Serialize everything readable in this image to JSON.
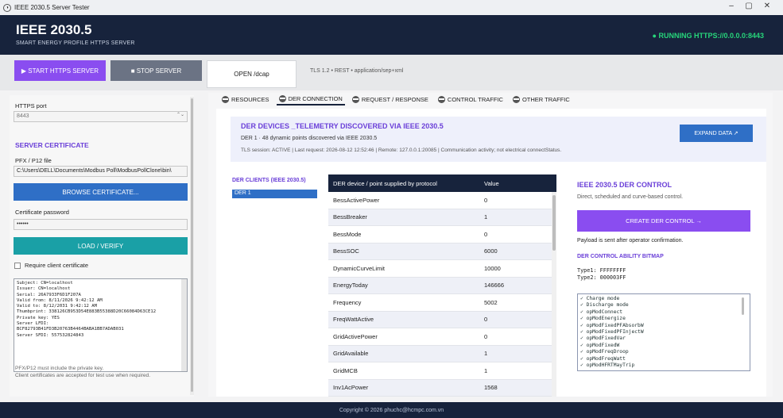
{
  "window": {
    "title": "IEEE 2030.5 Server Tester"
  },
  "header": {
    "title": "IEEE 2030.5",
    "subtitle": "SMART ENERGY PROFILE HTTPS SERVER",
    "status": "● RUNNING HTTPS://0.0.0.0:8443"
  },
  "toolbar": {
    "start_label": "▶  START HTTPS SERVER",
    "stop_label": "■  STOP SERVER",
    "open_label": "OPEN /dcap",
    "info": "TLS 1.2 • REST • application/sep+xml"
  },
  "left": {
    "port_label": "HTTPS port",
    "port_value": "8443",
    "cert_heading": "SERVER CERTIFICATE",
    "pfx_label": "PFX / P12 file",
    "pfx_value": "C:\\Users\\DELL\\Documents\\Modbus Poll\\ModbusPollClone\\bin\\",
    "browse_label": "BROWSE CERTIFICATE...",
    "password_label": "Certificate password",
    "password_value": "••••••",
    "load_label": "LOAD / VERIFY",
    "require_label": "Require client certificate",
    "cert_info": "Subject: CN=localhost\nIssuer: CN=localhost\nSerial: 26A7933F6D1F207A\nValid from: 8/11/2026 9:42:12 AM\nValid to: 8/12/2031 9:42:12 AM\nThumbprint: 338126CB953D54E883B55388D20C66084D63CE12\nPrivate key: YES\nServer LFDI:\nBCF82793B41FD3B20763B4464BABA1BB7ADAB031\nServer SFDI: 557532824843",
    "note1": "PFX/P12 must include the private key.",
    "note2": "Client certificates are accepted for test use when required."
  },
  "tabs": [
    "RESOURCES",
    "DER CONNECTION",
    "REQUEST / RESPONSE",
    "CONTROL TRAFFIC",
    "OTHER TRAFFIC"
  ],
  "der": {
    "banner_title": "DER DEVICES _TELEMETRY DISCOVERED VIA IEEE 2030.5",
    "banner_sub": "DER 1 · 48 dynamic points discovered via IEEE 2030.5",
    "banner_status": "TLS session: ACTIVE  |  Last request: 2026-08-12 12:52:46  |  Remote: 127.0.0.1:20085  |  Communication activity; not electrical connectStatus.",
    "expand_label": "EXPAND DATA ↗",
    "clients_heading": "DER CLIENTS (IEEE 2030.5)",
    "clients": [
      "DER 1"
    ],
    "table_headers": [
      "DER device / point supplied by protocol",
      "Value"
    ],
    "rows": [
      [
        "BessActivePower",
        "0"
      ],
      [
        "BessBreaker",
        "1"
      ],
      [
        "BessMode",
        "0"
      ],
      [
        "BessSOC",
        "6000"
      ],
      [
        "DynamicCurveLimit",
        "10000"
      ],
      [
        "EnergyToday",
        "146666"
      ],
      [
        "Frequency",
        "5002"
      ],
      [
        "FreqWattActive",
        "0"
      ],
      [
        "GridActivePower",
        "0"
      ],
      [
        "GridAvailable",
        "1"
      ],
      [
        "GridMCB",
        "1"
      ],
      [
        "Inv1AcPower",
        "1568"
      ]
    ]
  },
  "control": {
    "title": "IEEE 2030.5 DER CONTROL",
    "sub": "Direct, scheduled and curve-based control.",
    "create_label": "CREATE DER CONTROL →",
    "payload_note": "Payload is sent after operator confirmation.",
    "bitmap_heading": "DER CONTROL ABILITY BITMAP",
    "type1": "Type1: FFFFFFFF",
    "type2": "Type2: 000003FF",
    "abilities": [
      "Charge mode",
      "Discharge mode",
      "opModConnect",
      "opModEnergize",
      "opModFixedPFAbsorbW",
      "opModFixedPFInjectW",
      "opModFixedVar",
      "opModFixedW",
      "opModFreqDroop",
      "opModFreqWatt",
      "opModHFRTMayTrip"
    ]
  },
  "footer": {
    "text": "Copyright © 2026 phuchc@hcmpc.com.vn"
  },
  "colors": {
    "navy": "#17233c",
    "purple": "#8a4df0",
    "blue": "#2f6fc6",
    "teal": "#1aa0a6",
    "green": "#27d67b"
  }
}
